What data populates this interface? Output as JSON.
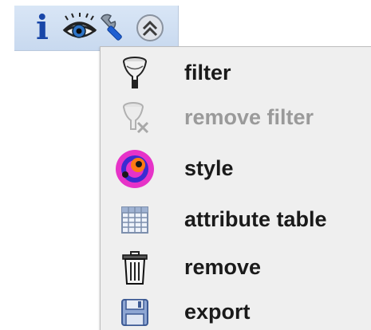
{
  "toolbar": {
    "info_glyph": "i",
    "buttons": [
      {
        "icon": "info-icon"
      },
      {
        "icon": "eye-icon"
      },
      {
        "icon": "wrench-icon"
      },
      {
        "icon": "collapse-up-icon"
      }
    ]
  },
  "menu": {
    "items": [
      {
        "label": "filter",
        "icon": "funnel-icon",
        "enabled": true
      },
      {
        "label": "remove filter",
        "icon": "remove-filter-icon",
        "enabled": false
      },
      {
        "label": "style",
        "icon": "style-palette-icon",
        "enabled": true
      },
      {
        "label": "attribute table",
        "icon": "table-icon",
        "enabled": true
      },
      {
        "label": "remove",
        "icon": "trash-icon",
        "enabled": true
      },
      {
        "label": "export",
        "icon": "save-disk-icon",
        "enabled": true
      }
    ]
  },
  "colors": {
    "toolbar_bg": "#cddcf0",
    "menu_bg": "#efefef",
    "label_text": "#1a1a1a",
    "disabled_text": "#9a9a9a",
    "info_blue": "#1846a8"
  }
}
